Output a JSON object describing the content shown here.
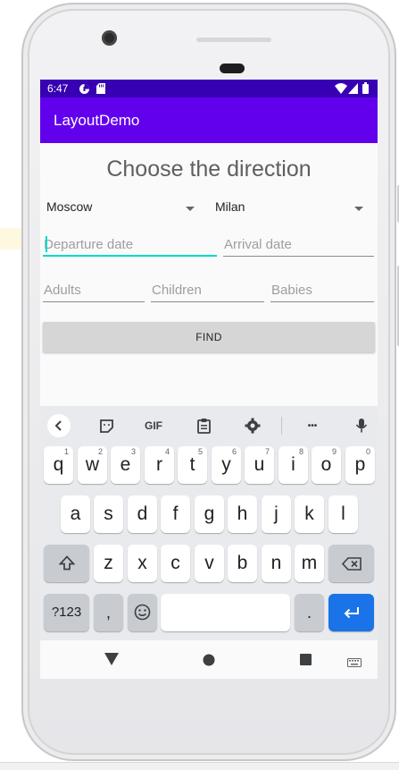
{
  "status_bar": {
    "time": "6:47"
  },
  "app_bar": {
    "title": "LayoutDemo"
  },
  "main": {
    "heading": "Choose the direction",
    "from_city": "Moscow",
    "to_city": "Milan",
    "departure_placeholder": "Departure date",
    "arrival_placeholder": "Arrival date",
    "adults_placeholder": "Adults",
    "children_placeholder": "Children",
    "babies_placeholder": "Babies",
    "find_label": "FIND"
  },
  "keyboard": {
    "toolbar": {
      "gif_label": "GIF",
      "more_label": "•••"
    },
    "row1": [
      {
        "key": "q",
        "hint": "1"
      },
      {
        "key": "w",
        "hint": "2"
      },
      {
        "key": "e",
        "hint": "3"
      },
      {
        "key": "r",
        "hint": "4"
      },
      {
        "key": "t",
        "hint": "5"
      },
      {
        "key": "y",
        "hint": "6"
      },
      {
        "key": "u",
        "hint": "7"
      },
      {
        "key": "i",
        "hint": "8"
      },
      {
        "key": "o",
        "hint": "9"
      },
      {
        "key": "p",
        "hint": "0"
      }
    ],
    "row2": [
      "a",
      "s",
      "d",
      "f",
      "g",
      "h",
      "j",
      "k",
      "l"
    ],
    "row3": [
      "z",
      "x",
      "c",
      "v",
      "b",
      "n",
      "m"
    ],
    "row4": {
      "symbols": "?123",
      "comma": ",",
      "period": "."
    }
  },
  "colors": {
    "status_bar": "#3700b3",
    "app_bar": "#6200ee",
    "focus_accent": "#03dac5",
    "enter_key": "#1a73e8"
  }
}
